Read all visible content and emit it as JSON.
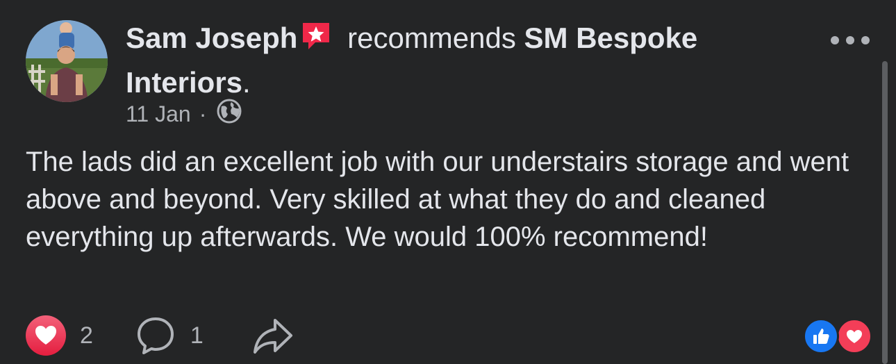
{
  "post": {
    "author_name": "Sam Joseph",
    "recommends_text": "recommends",
    "page_name": "SM Bespoke Interiors",
    "header_end": ".",
    "date": "11 Jan",
    "separator": "·",
    "privacy_icon": "globe-icon",
    "body": "The lads did an excellent job with our understairs storage and went above and beyond. Very skilled at what they do and cleaned everything up afterwards. We would 100% recommend!"
  },
  "actions": {
    "love_count": "2",
    "comment_count": "1"
  },
  "reactions": [
    "like",
    "love"
  ],
  "colors": {
    "background": "#242526",
    "text_primary": "#e4e6eb",
    "text_secondary": "#b0b3b8",
    "love_red": "#f33e58",
    "like_blue": "#1877f2",
    "recommend_badge": "#f02849"
  }
}
